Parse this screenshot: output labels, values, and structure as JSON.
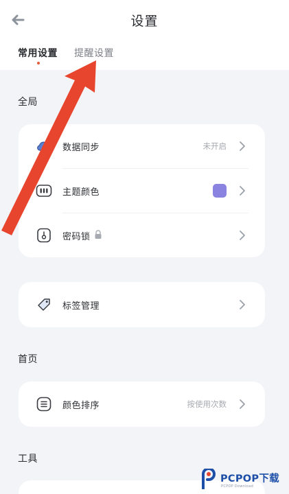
{
  "header": {
    "title": "设置",
    "back_icon": "back-arrow-icon"
  },
  "tabs": [
    {
      "label": "常用设置",
      "active": true
    },
    {
      "label": "提醒设置",
      "active": false
    }
  ],
  "sections": {
    "global": {
      "label": "全局",
      "items": [
        {
          "label": "数据同步",
          "value": "未开启",
          "icon": "cloud-icon"
        },
        {
          "label": "主题颜色",
          "swatch_color": "#8b83e0",
          "icon": "palette-icon"
        },
        {
          "label": "密码锁",
          "icon": "password-lock-icon",
          "badge_icon": "padlock-icon"
        }
      ]
    },
    "tags": {
      "items": [
        {
          "label": "标签管理",
          "icon": "tag-icon"
        }
      ]
    },
    "home": {
      "label": "首页",
      "items": [
        {
          "label": "颜色排序",
          "value": "按使用次数",
          "icon": "list-icon"
        }
      ]
    },
    "tools": {
      "label": "工具"
    }
  },
  "colors": {
    "accent_dot": "#e65a3c",
    "arrow": "#e8452f",
    "theme_swatch": "#8b83e0",
    "background": "#f3f4f8"
  },
  "watermark": {
    "main": "PCPOP下载",
    "sub": "PCPOP Download"
  }
}
